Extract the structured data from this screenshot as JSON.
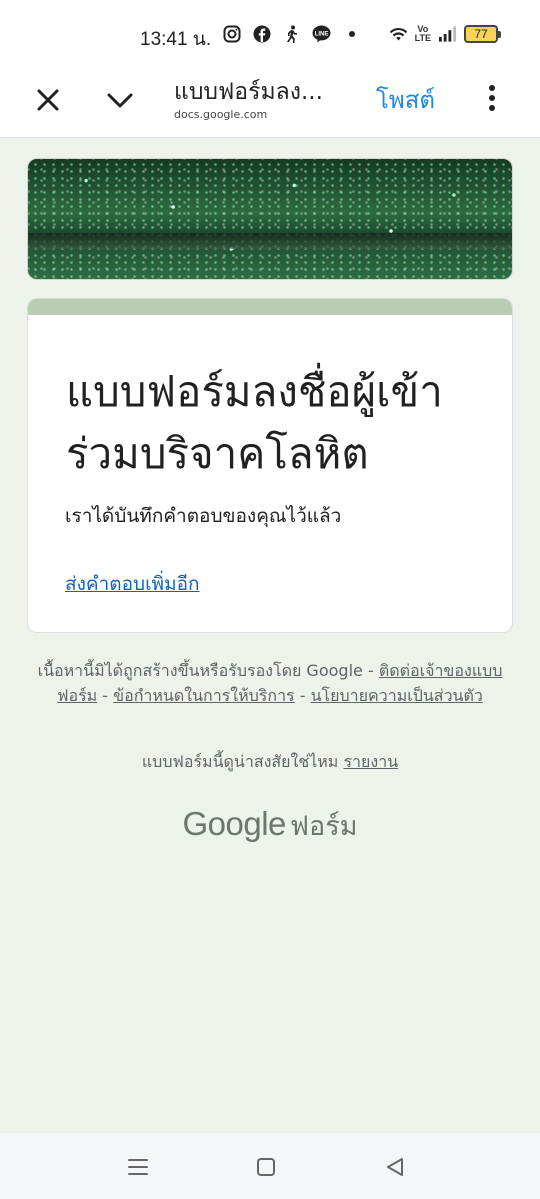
{
  "status_bar": {
    "time": "13:41 น.",
    "battery": "77",
    "network": "VoLTE",
    "icons": [
      "instagram-icon",
      "facebook-icon",
      "walking-icon",
      "line-icon",
      "dot-icon",
      "wifi-icon",
      "signal-icon",
      "battery-icon"
    ]
  },
  "toolbar": {
    "title": "แบบฟอร์มลง...",
    "url": "docs.google.com",
    "post_label": "โพสต์"
  },
  "card": {
    "title": "แบบฟอร์มลงชื่อผู้เข้าร่วมบริจาคโลหิต",
    "message": "เราได้บันทึกคำตอบของคุณไว้แล้ว",
    "link": "ส่งคำตอบเพิ่มอีก"
  },
  "footer": {
    "notice": "เนื้อหานี้มิได้ถูกสร้างขึ้นหรือรับรองโดย Google -",
    "contact_link": "ติดต่อเจ้าของแบบฟอร์ม",
    "sep1": " - ",
    "terms_link": "ข้อกำหนดในการให้บริการ",
    "sep2": " - ",
    "privacy_link": "นโยบายความเป็นส่วนตัว",
    "suspicious": "แบบฟอร์มนี้ดูน่าสงสัยใช่ไหม",
    "report_link": "รายงาน",
    "logo_google": "Google",
    "logo_forms": "ฟอร์ม"
  },
  "colors": {
    "accent": "#1e88e5",
    "page_bg": "#edf2ea",
    "card_header": "#b9cdb3",
    "link": "#1a5fb4"
  }
}
